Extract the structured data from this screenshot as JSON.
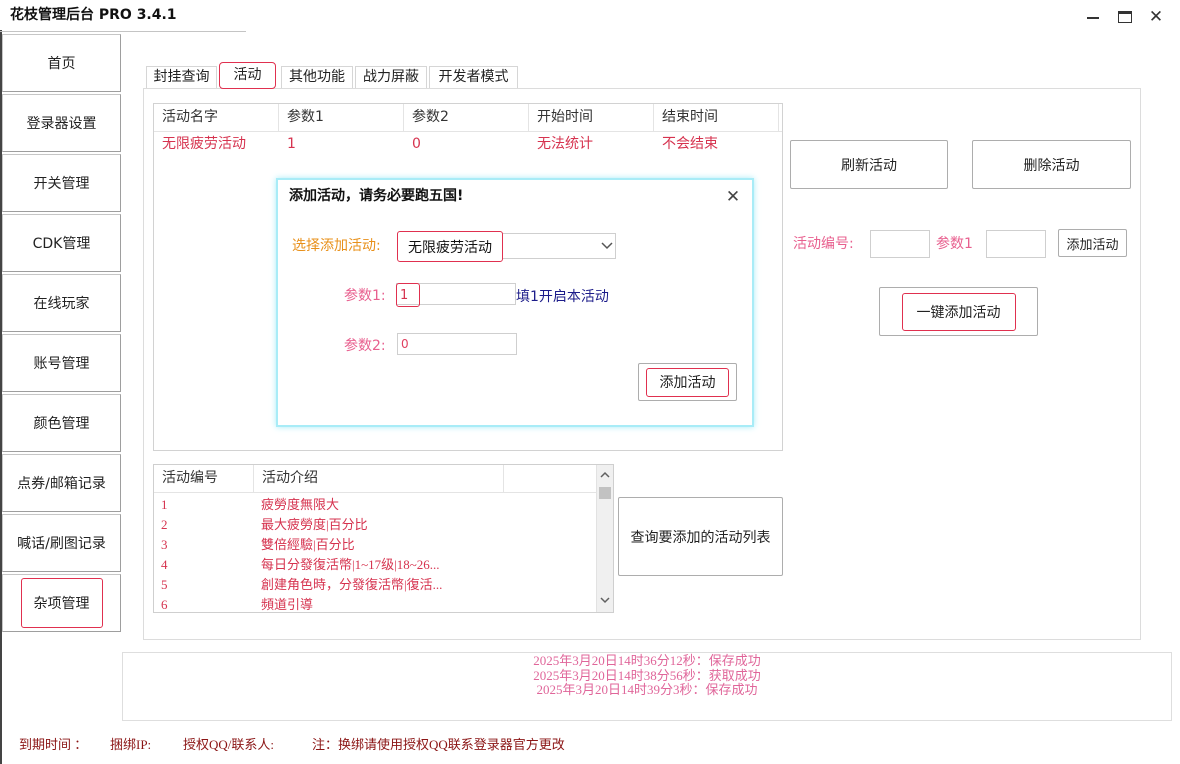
{
  "window": {
    "title": "花枝管理后台 PRO 3.4.1",
    "icons": {
      "minimize": "minimize-icon",
      "maximize": "maximize-icon",
      "close": "close-icon"
    }
  },
  "sidebar": {
    "items": [
      {
        "label": "首页",
        "active": false
      },
      {
        "label": "登录器设置",
        "active": false
      },
      {
        "label": "开关管理",
        "active": false
      },
      {
        "label": "CDK管理",
        "active": false
      },
      {
        "label": "在线玩家",
        "active": false
      },
      {
        "label": "账号管理",
        "active": false
      },
      {
        "label": "颜色管理",
        "active": false
      },
      {
        "label": "点券/邮箱记录",
        "active": false
      },
      {
        "label": "喊话/刷图记录",
        "active": false
      },
      {
        "label": "杂项管理",
        "active": true
      }
    ]
  },
  "tabs": [
    {
      "label": "封挂查询",
      "selected": false
    },
    {
      "label": "活动",
      "selected": true
    },
    {
      "label": "其他功能",
      "selected": false
    },
    {
      "label": "战力屏蔽",
      "selected": false
    },
    {
      "label": "开发者模式",
      "selected": false
    }
  ],
  "activity_table": {
    "columns": [
      "活动名字",
      "参数1",
      "参数2",
      "开始时间",
      "结束时间"
    ],
    "rows": [
      [
        "无限疲劳活动",
        "1",
        "0",
        "无法统计",
        "不会结束"
      ]
    ]
  },
  "actions": {
    "refresh_label": "刷新活动",
    "delete_label": "删除活动",
    "id_label": "活动编号:",
    "id_value": "",
    "param1_label": "参数1",
    "param1_value": "",
    "add_label": "添加活动",
    "one_click_add_label": "一键添加活动"
  },
  "dialog": {
    "title": "添加活动，请务必要跑五国!",
    "close_icon": "close-icon",
    "select_label": "选择添加活动:",
    "select_value": "无限疲劳活动",
    "select_icon": "chevron-down-icon",
    "param1_label": "参数1:",
    "param1_value": "1",
    "param1_hint": "填1开启本活动",
    "param2_label": "参数2:",
    "param2_value": "0",
    "submit_label": "添加活动"
  },
  "catalog": {
    "columns": [
      "活动编号",
      "活动介绍"
    ],
    "rows": [
      {
        "id": "1",
        "desc": "疲勞度無限大"
      },
      {
        "id": "2",
        "desc": "最大疲勞度|百分比"
      },
      {
        "id": "3",
        "desc": "雙倍經驗|百分比"
      },
      {
        "id": "4",
        "desc": "每日分發復活幣|1~17级|18~26..."
      },
      {
        "id": "5",
        "desc": "創建角色時，分發復活幣|復活..."
      },
      {
        "id": "6",
        "desc": "頻道引導"
      }
    ],
    "query_button_label": "查询要添加的活动列表",
    "scroll_icons": {
      "up": "chevron-up-icon",
      "down": "chevron-down-icon"
    }
  },
  "log": {
    "lines": [
      "2025年3月20日14时36分12秒：保存成功",
      "2025年3月20日14时38分56秒：获取成功",
      "2025年3月20日14时39分3秒：保存成功"
    ]
  },
  "footer": {
    "expiry_label": "到期时间 ：",
    "bound_ip_label": "捆绑IP:",
    "auth_contact_label": "授权QQ/联系人:",
    "note": "注：换绑请使用授权QQ联系登录器官方更改"
  },
  "colors": {
    "accent": "#e0304f",
    "row_text": "#d6334f",
    "label_pink": "#e8608f",
    "select_label": "#e8901a",
    "hint_blue": "#1c1c8a",
    "log_text": "#e0669a",
    "footer_text": "#8b1515",
    "dialog_glow": "#a8ecf7"
  }
}
